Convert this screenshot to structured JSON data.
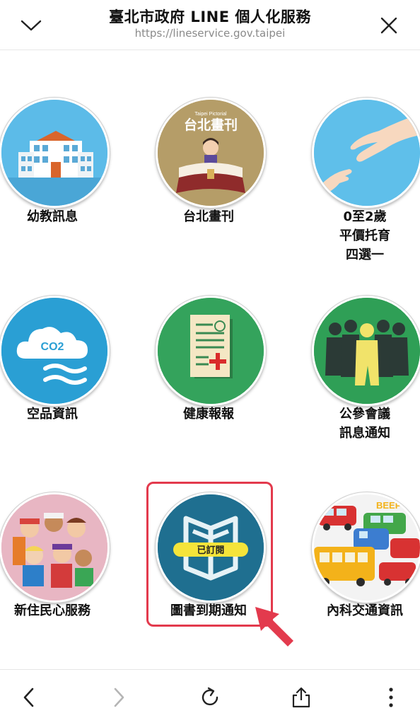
{
  "header": {
    "title": "臺北市政府 LINE 個人化服務",
    "url": "https://lineservice.gov.taipei",
    "collapse_icon": "chevron-down-icon",
    "close_icon": "close-icon"
  },
  "services": [
    {
      "label": "幼教訊息",
      "icon": "kindergarten-building-icon"
    },
    {
      "label": "台北畫刊",
      "icon": "taipei-pictorial-icon",
      "icon_text": "台北畫刊",
      "icon_small_text": "Taipei Pictorial"
    },
    {
      "label_lines": [
        "0至2歲",
        "平價托育",
        "四選一"
      ],
      "icon": "adult-child-hands-icon"
    },
    {
      "label": "空品資訊",
      "icon": "co2-cloud-icon",
      "icon_text": "CO2"
    },
    {
      "label": "健康報報",
      "icon": "health-document-icon"
    },
    {
      "label_lines": [
        "公參會議",
        "訊息通知"
      ],
      "icon": "group-of-people-icon"
    },
    {
      "label": "新住民心服務",
      "icon": "multicultural-children-icon"
    },
    {
      "label": "圖書到期通知",
      "icon": "open-book-icon",
      "badge": "已訂閱",
      "highlighted": true
    },
    {
      "label": "內科交通資訊",
      "icon": "traffic-jam-icon",
      "icon_text": "BEEP"
    }
  ],
  "colors": {
    "highlight": "#e33a4d",
    "badge": "#f5e43a",
    "library_bg": "#1f6f8f"
  },
  "bottom_nav": {
    "back_icon": "back-arrow-icon",
    "forward_icon": "forward-arrow-icon",
    "refresh_icon": "refresh-icon",
    "share_icon": "share-icon",
    "more_icon": "more-vertical-icon"
  }
}
